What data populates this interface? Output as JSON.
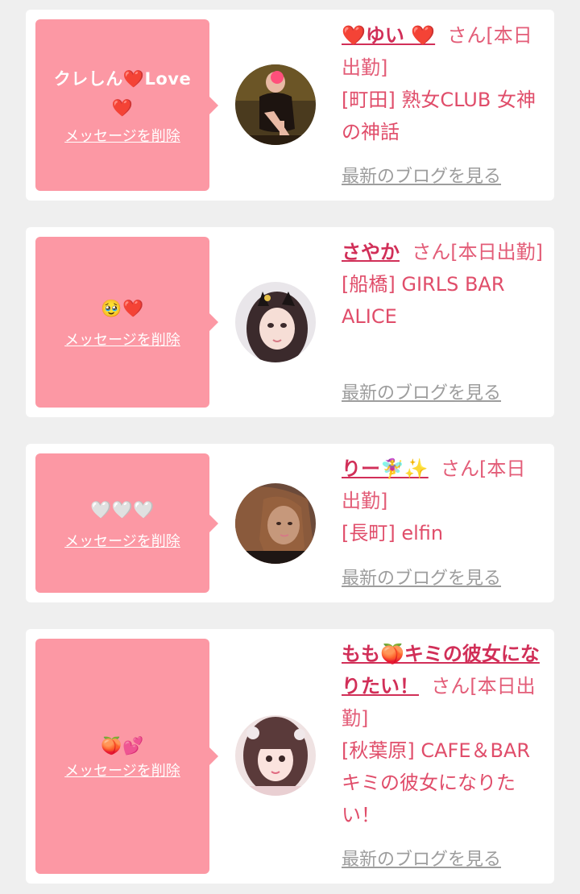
{
  "common": {
    "delete_label": "メッセージを削除",
    "blog_label": "最新のブログを見る"
  },
  "colors": {
    "page_bg": "#efefef",
    "card_bg": "#ffffff",
    "bubble_bg": "#fc98a4",
    "name_color": "#d12f58",
    "shop_color": "#e04d6a",
    "blog_link_color": "#9d9d9d"
  },
  "cards": [
    {
      "message_text": "クレしん",
      "message_icon_1": "❤️",
      "message_suffix": "Love",
      "message_icon_2": "❤️",
      "name": "❤️ゆい ❤️",
      "status": "さん[本日出勤]",
      "area": "[町田]",
      "shop": "熟女CLUB 女神の神話",
      "avatar_icon": "girl-portrait-dark-dress"
    },
    {
      "message_icon_1": "🥹",
      "message_icon_2": "❤️",
      "name": "さやか",
      "status": "さん[本日出勤]",
      "area": "[船橋]",
      "shop": "GIRLS BAR ALICE",
      "avatar_icon": "girl-portrait-cat-ears"
    },
    {
      "message_icon_1": "🤍🤍🤍",
      "name": "りー🧚‍♀️✨",
      "status": "さん[本日出勤]",
      "area": "[長町]",
      "shop": "elfin",
      "avatar_icon": "girl-portrait-brown-hair"
    },
    {
      "message_icon_1": "🍑",
      "message_icon_2": "💕",
      "name": "もも🍑キミの彼女になりたい！",
      "status": "さん[本日出勤]",
      "area": "[秋葉原]",
      "shop": "CAFE＆BAR キミの彼女になりたい！",
      "avatar_icon": "girl-portrait-twin-tails"
    }
  ]
}
